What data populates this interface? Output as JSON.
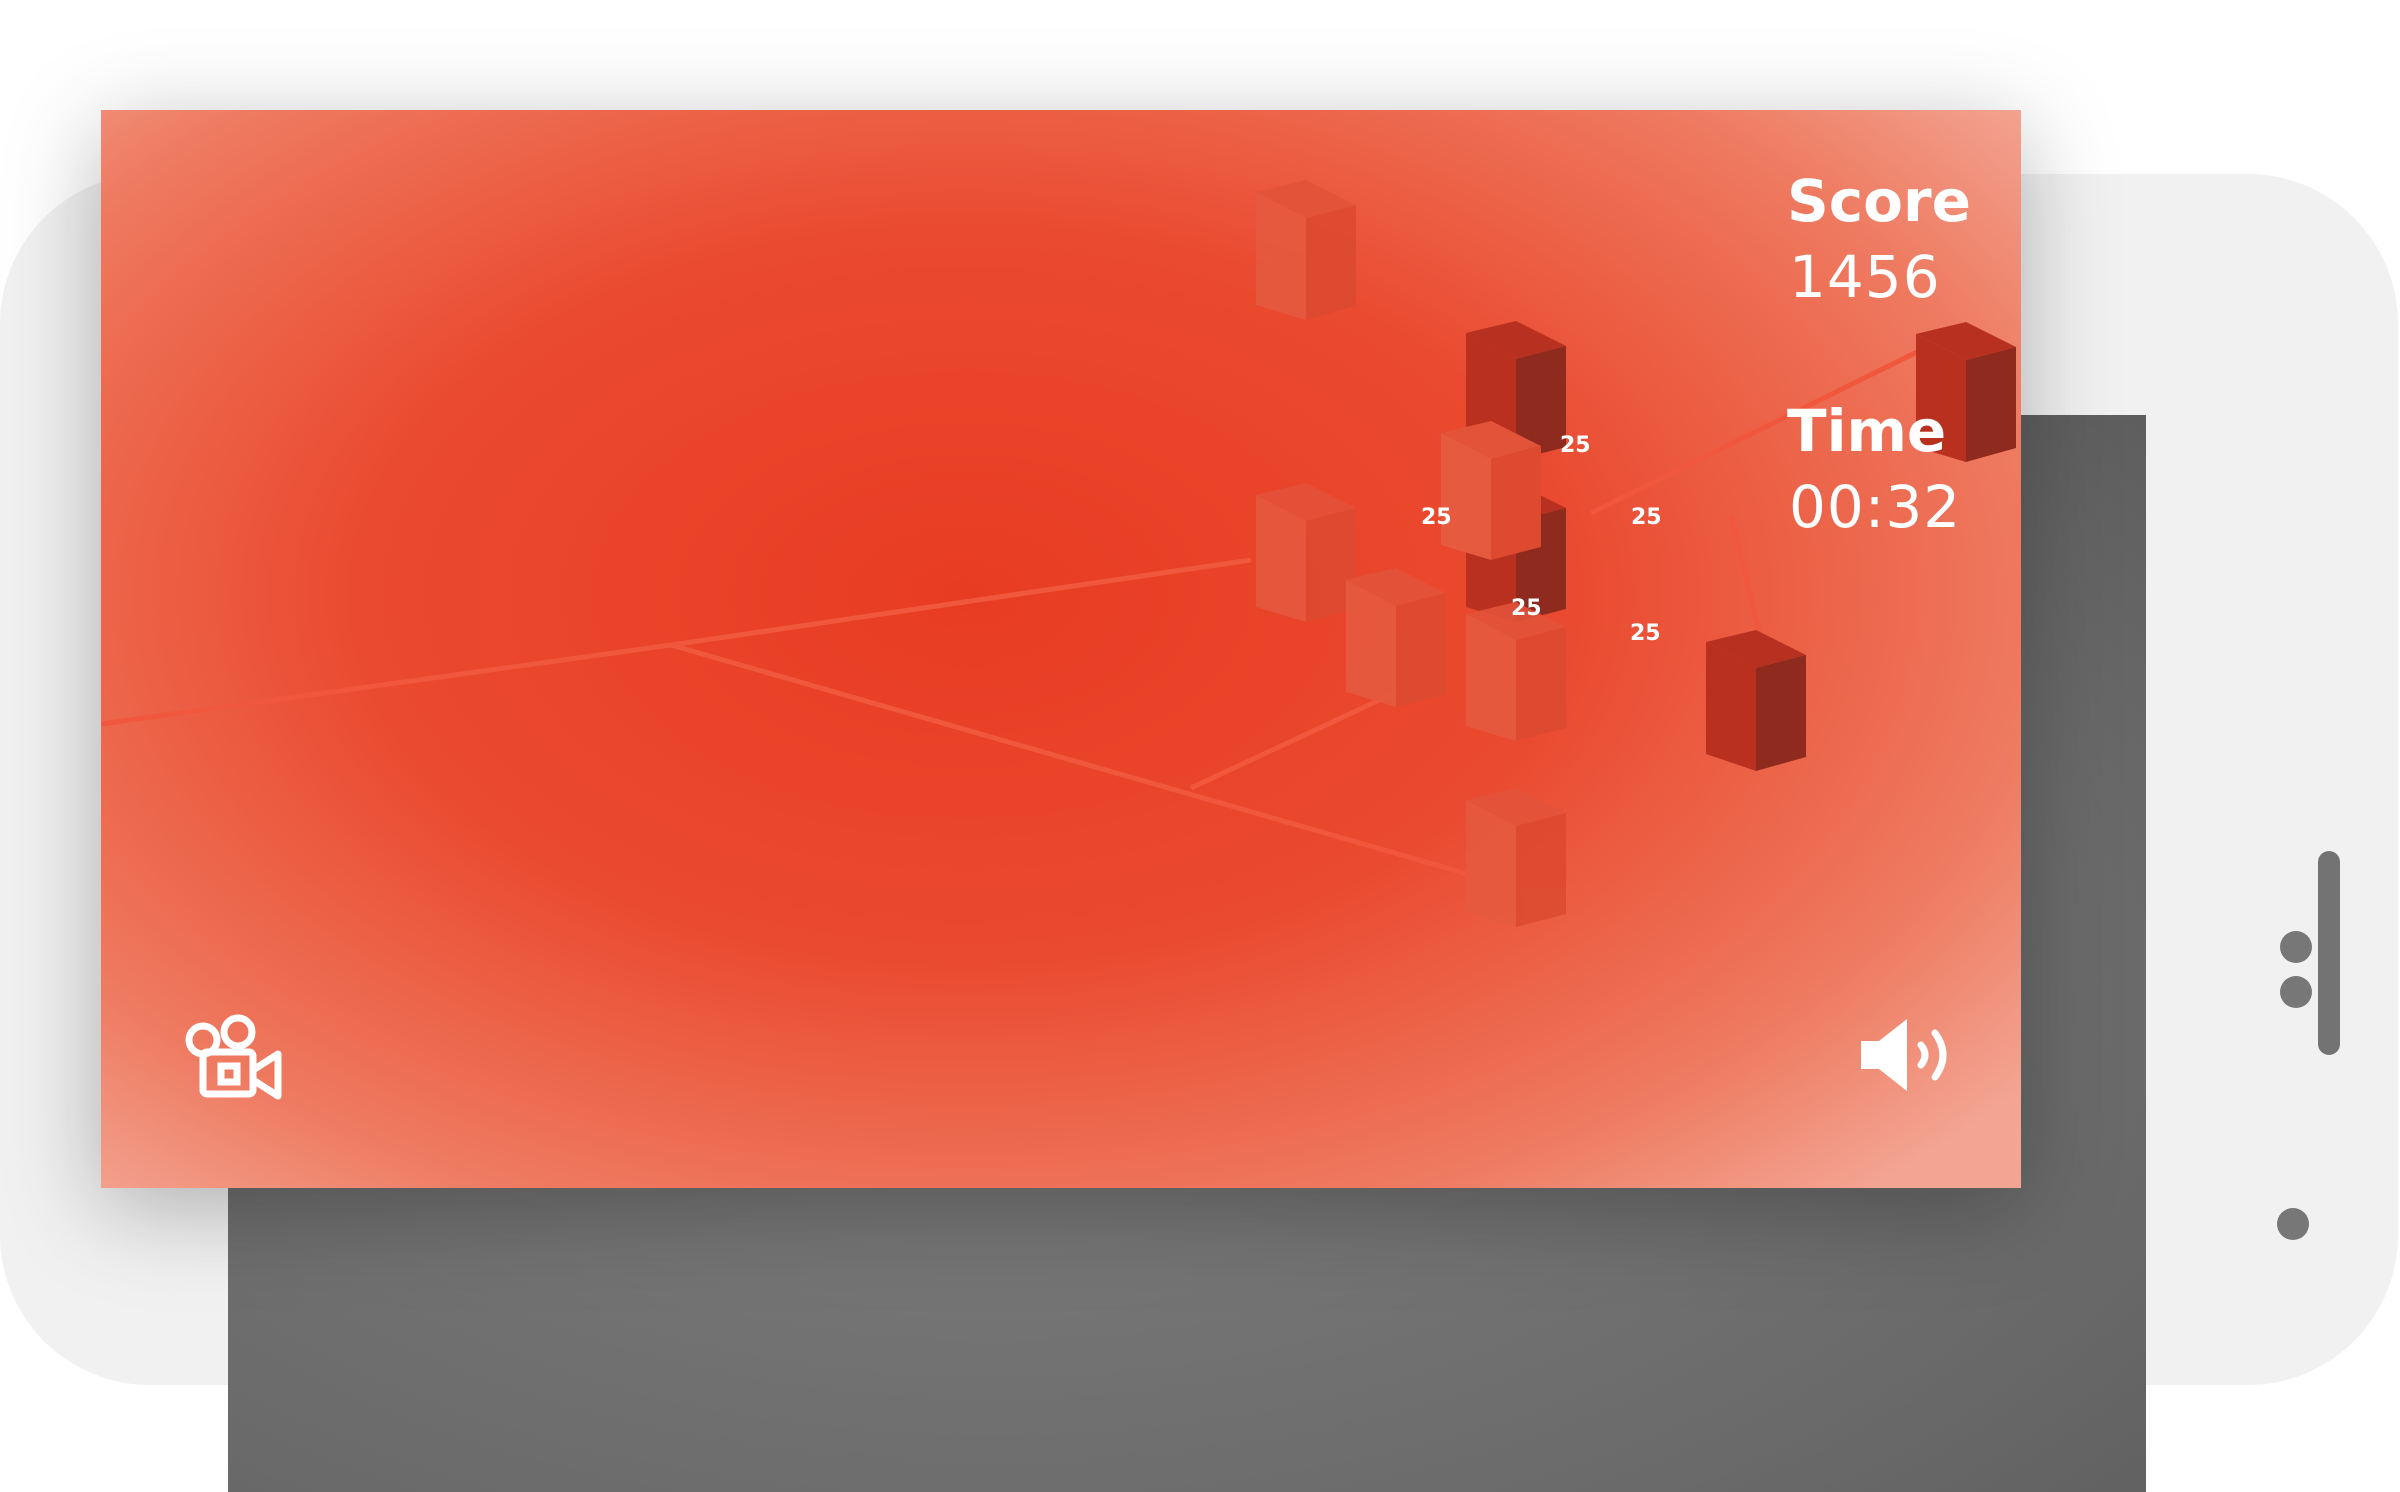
{
  "hud": {
    "score_label": "Score",
    "score_value": "1456",
    "time_label": "Time",
    "time_value": "00:32"
  },
  "points": {
    "p1": "25",
    "p2": "25",
    "p3": "25",
    "p4": "25",
    "p5": "25"
  },
  "controls": {
    "camera_icon": "camera-icon",
    "sound_icon": "speaker-icon"
  },
  "colors": {
    "background": "#e83c22",
    "cube_light": "#e04a32",
    "cube_dark": "#8e2a1e",
    "text": "#ffffff"
  }
}
